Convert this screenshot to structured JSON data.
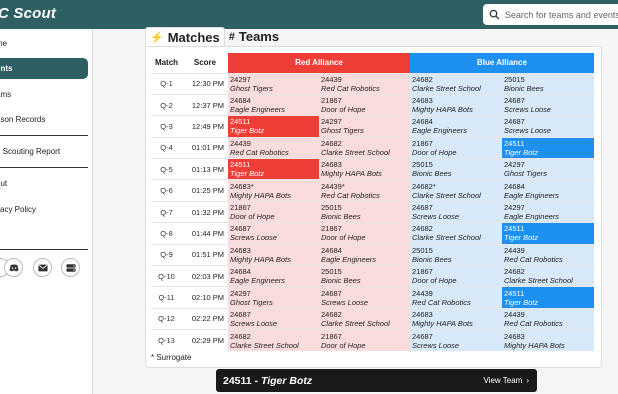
{
  "app": {
    "title": "C Scout"
  },
  "search": {
    "placeholder": "Search for teams and events"
  },
  "sidebar": {
    "items": [
      {
        "label": "me",
        "active": false
      },
      {
        "label": "ents",
        "active": true
      },
      {
        "label": "ams",
        "active": false
      },
      {
        "label": "ason Records",
        "active": false
      },
      {
        "label": "e Scouting Report",
        "active": false
      },
      {
        "label": "out",
        "active": false
      },
      {
        "label": "vacy Policy",
        "active": false
      },
      {
        "label": "l",
        "active": false
      }
    ],
    "social": [
      "",
      "discord-icon",
      "email-icon",
      "server-icon"
    ]
  },
  "tabs": [
    {
      "label": "Matches",
      "icon": "lightning-icon",
      "active": true
    },
    {
      "label": "Teams",
      "icon": "hash-icon",
      "active": false
    }
  ],
  "table": {
    "headers": {
      "match": "Match",
      "score": "Score",
      "red": "Red Alliance",
      "blue": "Blue Alliance"
    },
    "rows": [
      {
        "match": "Q-1",
        "time": "12:30 PM",
        "red": [
          {
            "num": "24297",
            "name": "Ghost Tigers"
          },
          {
            "num": "24439",
            "name": "Red Cat Robotics"
          }
        ],
        "blue": [
          {
            "num": "24682",
            "name": "Clarke Street School"
          },
          {
            "num": "25015",
            "name": "Bionic Bees"
          }
        ]
      },
      {
        "match": "Q-2",
        "time": "12:37 PM",
        "red": [
          {
            "num": "24684",
            "name": "Eagle Engineers"
          },
          {
            "num": "21867",
            "name": "Door of Hope"
          }
        ],
        "blue": [
          {
            "num": "24683",
            "name": "Mighty HAPA Bots"
          },
          {
            "num": "24687",
            "name": "Screws Loose"
          }
        ]
      },
      {
        "match": "Q-3",
        "time": "12:49 PM",
        "red": [
          {
            "num": "24511",
            "name": "Tiger Botz",
            "hl": true
          },
          {
            "num": "24297",
            "name": "Ghost Tigers"
          }
        ],
        "blue": [
          {
            "num": "24684",
            "name": "Eagle Engineers"
          },
          {
            "num": "24687",
            "name": "Screws Loose"
          }
        ]
      },
      {
        "match": "Q-4",
        "time": "01:01 PM",
        "red": [
          {
            "num": "24439",
            "name": "Red Cat Robotics"
          },
          {
            "num": "24682",
            "name": "Clarke Street School"
          }
        ],
        "blue": [
          {
            "num": "21867",
            "name": "Door of Hope"
          },
          {
            "num": "24511",
            "name": "Tiger Botz",
            "hl": true
          }
        ]
      },
      {
        "match": "Q-5",
        "time": "01:13 PM",
        "red": [
          {
            "num": "24511",
            "name": "Tiger Botz",
            "hl": true
          },
          {
            "num": "24683",
            "name": "Mighty HAPA Bots"
          }
        ],
        "blue": [
          {
            "num": "25015",
            "name": "Bionic Bees"
          },
          {
            "num": "24297",
            "name": "Ghost Tigers"
          }
        ]
      },
      {
        "match": "Q-6",
        "time": "01:25 PM",
        "red": [
          {
            "num": "24683*",
            "name": "Mighty HAPA Bots"
          },
          {
            "num": "24439*",
            "name": "Red Cat Robotics"
          }
        ],
        "blue": [
          {
            "num": "24682*",
            "name": "Clarke Street School"
          },
          {
            "num": "24684",
            "name": "Eagle Engineers"
          }
        ]
      },
      {
        "match": "Q-7",
        "time": "01:32 PM",
        "red": [
          {
            "num": "21867",
            "name": "Door of Hope"
          },
          {
            "num": "25015",
            "name": "Bionic Bees"
          }
        ],
        "blue": [
          {
            "num": "24687",
            "name": "Screws Loose"
          },
          {
            "num": "24297",
            "name": "Eagle Engineers"
          }
        ]
      },
      {
        "match": "Q-8",
        "time": "01:44 PM",
        "red": [
          {
            "num": "24687",
            "name": "Screws Loose"
          },
          {
            "num": "21867",
            "name": "Door of Hope"
          }
        ],
        "blue": [
          {
            "num": "24682",
            "name": "Clarke Street School"
          },
          {
            "num": "24511",
            "name": "Tiger Botz",
            "hl": true
          }
        ]
      },
      {
        "match": "Q-9",
        "time": "01:51 PM",
        "red": [
          {
            "num": "24683",
            "name": "Mighty HAPA Bots"
          },
          {
            "num": "24684",
            "name": "Eagle Engineers"
          }
        ],
        "blue": [
          {
            "num": "25015",
            "name": "Bionic Bees"
          },
          {
            "num": "24439",
            "name": "Red Cat Robotics"
          }
        ]
      },
      {
        "match": "Q-10",
        "time": "02:03 PM",
        "red": [
          {
            "num": "24684",
            "name": "Eagle Engineers"
          },
          {
            "num": "25015",
            "name": "Bionic Bees"
          }
        ],
        "blue": [
          {
            "num": "21867",
            "name": "Door of Hope"
          },
          {
            "num": "24682",
            "name": "Clarke Street School"
          }
        ]
      },
      {
        "match": "Q-11",
        "time": "02:10 PM",
        "red": [
          {
            "num": "24297",
            "name": "Ghost Tigers"
          },
          {
            "num": "24687",
            "name": "Screws Loose"
          }
        ],
        "blue": [
          {
            "num": "24439",
            "name": "Red Cat Robotics"
          },
          {
            "num": "24511",
            "name": "Tiger Botz",
            "hl": true
          }
        ]
      },
      {
        "match": "Q-12",
        "time": "02:22 PM",
        "red": [
          {
            "num": "24687",
            "name": "Screws Loose"
          },
          {
            "num": "24682",
            "name": "Clarke Street School"
          }
        ],
        "blue": [
          {
            "num": "24683",
            "name": "Mighty HAPA Bots"
          },
          {
            "num": "24439",
            "name": "Red Cat Robotics"
          }
        ]
      },
      {
        "match": "Q-13",
        "time": "02:29 PM",
        "red": [
          {
            "num": "24682",
            "name": "Clarke Street School"
          },
          {
            "num": "21867",
            "name": "Door of Hope"
          }
        ],
        "blue": [
          {
            "num": "24687",
            "name": "Screws Loose"
          },
          {
            "num": "24683",
            "name": "Mighty HAPA Bots"
          }
        ]
      }
    ]
  },
  "footnote": "* Surrogate",
  "team_bar": {
    "number": "24511",
    "separator": " - ",
    "name": "Tiger Botz",
    "link": "View Team"
  },
  "colors": {
    "topbar": "#2e5f63",
    "red": "#ef3e36",
    "red_light": "#fbdcdc",
    "blue": "#1e90f0",
    "blue_light": "#d8eafa"
  }
}
